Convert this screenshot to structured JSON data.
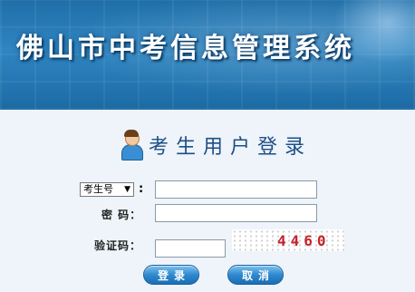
{
  "header": {
    "title": "佛山市中考信息管理系统"
  },
  "login": {
    "title": "考生用户登录",
    "id_type_select": {
      "selected": "考生号",
      "arrow": "▼"
    },
    "colon": ":",
    "id_value": "",
    "password_label": "密 码：",
    "password_value": "",
    "captcha_label": "验证码：",
    "captcha_value": "",
    "captcha_code": "4460",
    "login_button": "登录",
    "cancel_button": "取消"
  },
  "icons": {
    "user": "user-avatar-icon"
  },
  "colors": {
    "banner": "#2f86c2",
    "title_text": "#1e4f86",
    "captcha_text": "#c4232b",
    "button": "#2f89cf",
    "page_bg": "#eef4fa"
  }
}
